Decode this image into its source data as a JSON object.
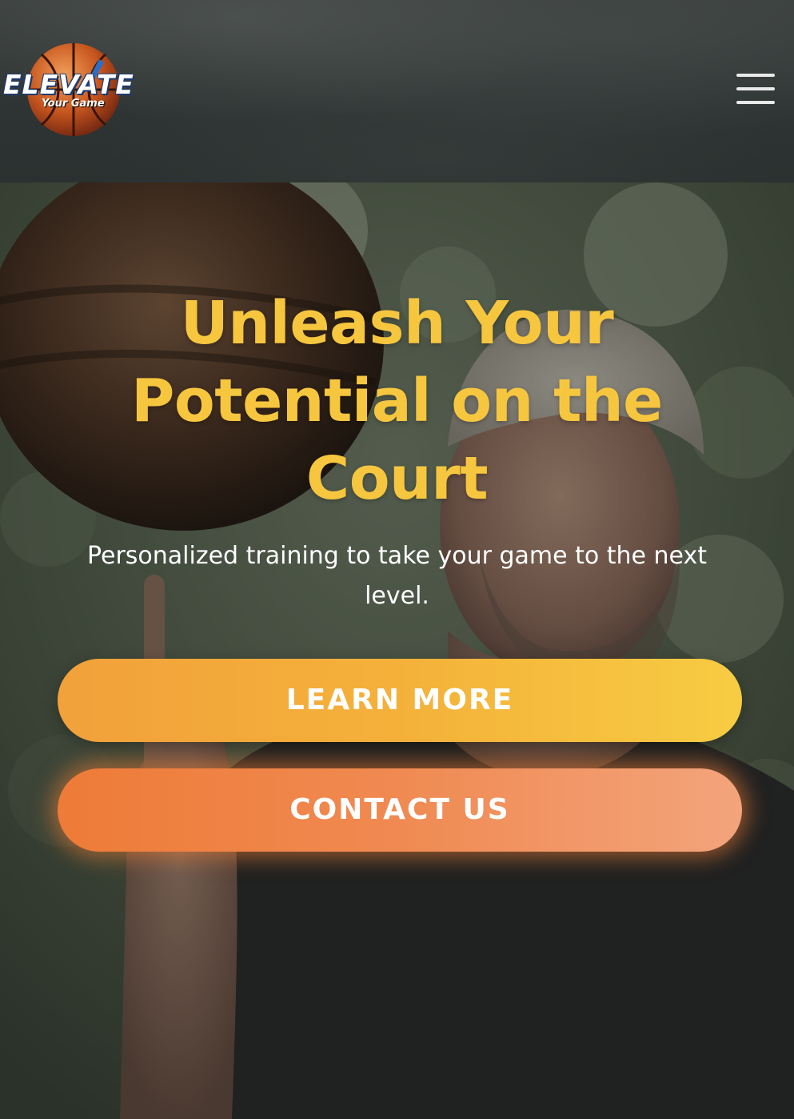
{
  "header": {
    "logo": {
      "wordmark": "ELEVATE",
      "tagline": "Your Game",
      "icon": "basketball-logo"
    },
    "menu_icon": "hamburger-menu-icon"
  },
  "hero": {
    "background": "player-spinning-basketball-photo",
    "title": "Unleash Your Potential on the Court",
    "subtitle": "Personalized training to take your game to the next level.",
    "buttons": {
      "learn_more": "LEARN MORE",
      "contact_us": "CONTACT US"
    }
  },
  "colors": {
    "title": "#f6c63f",
    "learn_more_start": "#f2a13b",
    "learn_more_end": "#f7cc42",
    "contact_start": "#ee7b37",
    "contact_end": "#f3a47c",
    "header_bg": "#2e3433"
  }
}
